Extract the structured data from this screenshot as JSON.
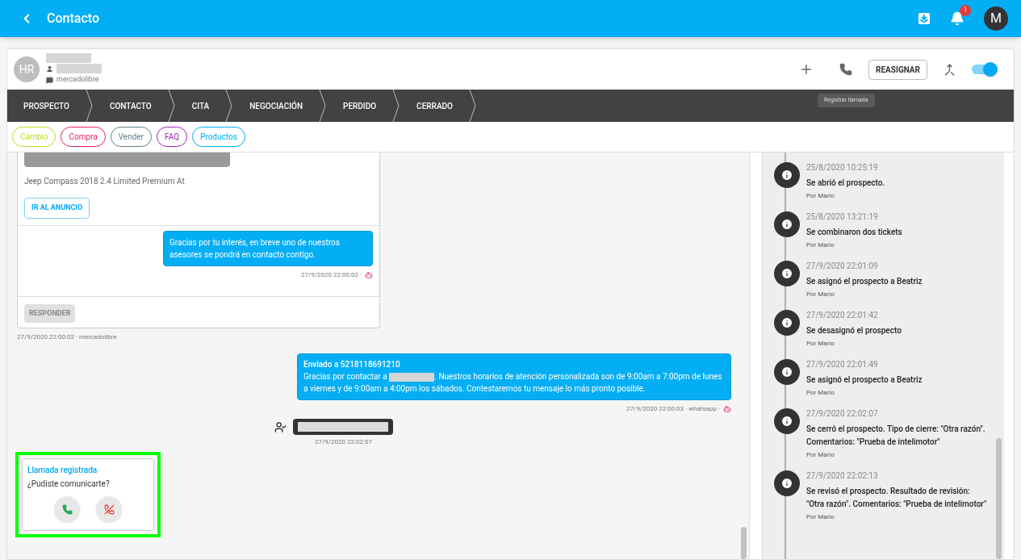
{
  "app_bar": {
    "title": "Contacto",
    "notification_count": "1",
    "avatar_letter": "M"
  },
  "contact": {
    "initials": "HR",
    "source": "mercadolibre"
  },
  "actions": {
    "reassign_label": "REASIGNAR",
    "toggle_on": true,
    "tooltip": "Registrar llamada"
  },
  "stages": [
    "PROSPECTO",
    "CONTACTO",
    "CITA",
    "NEGOCIACIÓN",
    "PERDIDO",
    "CERRADO"
  ],
  "tags": [
    {
      "label": "Cambio",
      "color": "#c6d82a"
    },
    {
      "label": "Compra",
      "color": "#e91e63"
    },
    {
      "label": "Vender",
      "color": "#607d8b"
    },
    {
      "label": "FAQ",
      "color": "#9c27b0"
    },
    {
      "label": "Productos",
      "color": "#03a9f4"
    }
  ],
  "listing_card": {
    "title": "Jeep Compass 2018 2.4 Limited Premium At",
    "link_button": "IR AL ANUNCIO",
    "reply_text": "Gracias por tu interés, en breve uno de nuestros asesores se pondrá en contacto contigo.",
    "reply_time": "27/9/2020 22:00:02 ·",
    "reply_button": "RESPONDER",
    "footer": "27/9/2020 22:00:02 · mercadolibre"
  },
  "outgoing_message": {
    "header": "Enviado a 5218118691210",
    "text_before": "Gracias por contactar a",
    "text_after": ". Nuestros horarios de atención personalizada son de 9:00am a 7:00pm de lunes a viernes y de 9:00am a 4:00pm los sábados. Contestaremos tu mensaje lo más pronto posible.",
    "meta": "27/9/2020 22:00:03 · whatsapp ·"
  },
  "system_event": {
    "time": "27/9/2020 22:02:07"
  },
  "call_card": {
    "title": "Llamada registrada",
    "question": "¿Pudiste comunicarte?"
  },
  "timeline": [
    {
      "time": "25/8/2020 10:25:19",
      "text": "Se abrió el prospecto.",
      "by": "Por Mario"
    },
    {
      "time": "25/8/2020 13:21:19",
      "text": "Se combinaron dos tickets",
      "by": "Por Mario"
    },
    {
      "time": "27/9/2020 22:01:09",
      "text": "Se asignó el prospecto a Beatriz",
      "by": "Por Mario"
    },
    {
      "time": "27/9/2020 22:01:42",
      "text": "Se desasignó el prospecto",
      "by": "Por Mario"
    },
    {
      "time": "27/9/2020 22:01:49",
      "text": "Se asignó el prospecto a Beatriz",
      "by": "Por Mario"
    },
    {
      "time": "27/9/2020 22:02:07",
      "text": "Se cerró el prospecto. Tipo de cierre: \"Otra razón\". Comentarios: \"Prueba de intelimotor\"",
      "by": "Por Mario"
    },
    {
      "time": "27/9/2020 22:02:13",
      "text": "Se revisó el prospecto. Resultado de revisión: \"Otra razón\". Comentarios: \"Prueba de intelimotor\"",
      "by": "Por Mario"
    }
  ]
}
